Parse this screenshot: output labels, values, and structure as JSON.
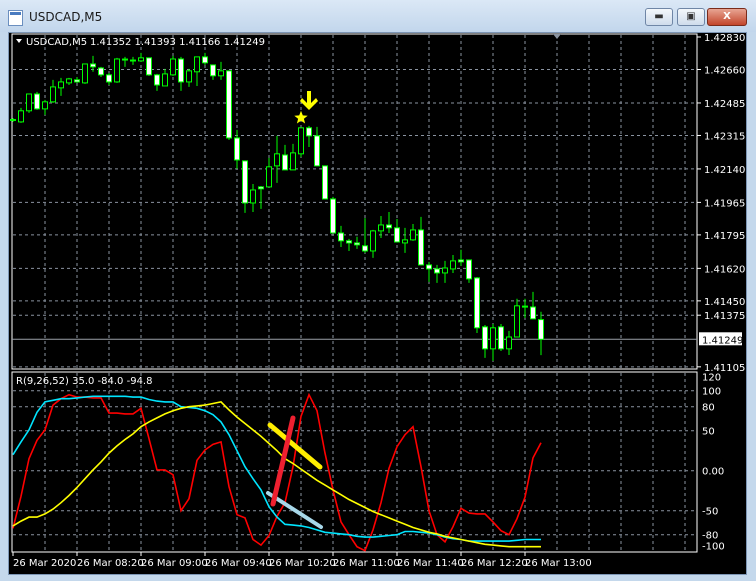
{
  "window": {
    "title": "USDCAD,M5",
    "buttons": [
      "minimize",
      "maximize",
      "close"
    ]
  },
  "chart": {
    "header_symbol": "USDCAD,M5",
    "header_ohlc": "1.41352 1.41393 1.41166 1.41249",
    "price_labels": [
      "1.42830",
      "1.42660",
      "1.42485",
      "1.42315",
      "1.42140",
      "1.41965",
      "1.41795",
      "1.41620",
      "1.41450",
      "1.41375",
      "1.41105"
    ],
    "current_price": "1.41249",
    "time_labels": [
      "26 Mar 2020",
      "26 Mar 08:20",
      "26 Mar 09:00",
      "26 Mar 09:40",
      "26 Mar 10:20",
      "26 Mar 11:00",
      "26 Mar 11:40",
      "26 Mar 12:20",
      "26 Mar 13:00"
    ],
    "colors": {
      "background": "#000000",
      "grid": "#8a93a0",
      "candle_outline": "#00ff00",
      "bear_fill": "#ffffff",
      "bull_fill": "#000000",
      "signal": "#ffff00"
    }
  },
  "indicator": {
    "label": "R(9,26,52) 35.0 -84.0 -94.8",
    "axis_labels": [
      "120",
      "100",
      "80",
      "50",
      "0.00",
      "-50",
      "-80",
      "-100"
    ],
    "colors": {
      "fast": "#ff0000",
      "medium": "#00e5ff",
      "slow": "#ffff00",
      "trend_red": "#ee2030",
      "trend_yellow": "#ffee00",
      "trend_blue": "#a8d8ea"
    }
  },
  "chart_data": {
    "type": "candlestick",
    "symbol": "USDCAD",
    "timeframe": "M5",
    "ylim": [
      1.41105,
      1.4283
    ],
    "candles": [
      [
        "07:40",
        1.42396,
        1.42406,
        1.42386,
        1.42396
      ],
      [
        "07:45",
        1.42386,
        1.42459,
        1.42381,
        1.42444
      ],
      [
        "07:50",
        1.42444,
        1.42532,
        1.42433,
        1.42532
      ],
      [
        "07:55",
        1.42532,
        1.42543,
        1.42449,
        1.42454
      ],
      [
        "08:00",
        1.42454,
        1.42501,
        1.42423,
        1.42491
      ],
      [
        "08:05",
        1.42491,
        1.42606,
        1.42485,
        1.42569
      ],
      [
        "08:10",
        1.42564,
        1.42616,
        1.42522,
        1.42595
      ],
      [
        "08:15",
        1.4259,
        1.42616,
        1.42579,
        1.42611
      ],
      [
        "08:20",
        1.42606,
        1.42621,
        1.4259,
        1.42595
      ],
      [
        "08:25",
        1.4259,
        1.42689,
        1.42585,
        1.42689
      ],
      [
        "08:30",
        1.42689,
        1.42731,
        1.42648,
        1.42674
      ],
      [
        "08:35",
        1.42668,
        1.42674,
        1.42621,
        1.42632
      ],
      [
        "08:40",
        1.42632,
        1.42642,
        1.42579,
        1.42595
      ],
      [
        "08:45",
        1.42595,
        1.42721,
        1.4259,
        1.42715
      ],
      [
        "08:50",
        1.4271,
        1.42726,
        1.42674,
        1.42712
      ],
      [
        "08:55",
        1.42705,
        1.42726,
        1.42684,
        1.42707
      ],
      [
        "09:00",
        1.42705,
        1.42747,
        1.427,
        1.42721
      ],
      [
        "09:05",
        1.42721,
        1.42721,
        1.42627,
        1.42632
      ],
      [
        "09:10",
        1.42632,
        1.42637,
        1.42548,
        1.42579
      ],
      [
        "09:15",
        1.42574,
        1.42663,
        1.42574,
        1.42637
      ],
      [
        "09:20",
        1.42632,
        1.42731,
        1.42627,
        1.42715
      ],
      [
        "09:25",
        1.42715,
        1.42726,
        1.42548,
        1.42595
      ],
      [
        "09:30",
        1.42595,
        1.42663,
        1.42569,
        1.42653
      ],
      [
        "09:35",
        1.42648,
        1.42726,
        1.42574,
        1.42726
      ],
      [
        "09:40",
        1.42726,
        1.42747,
        1.42684,
        1.42695
      ],
      [
        "09:45",
        1.42684,
        1.42684,
        1.42606,
        1.42627
      ],
      [
        "09:50",
        1.42627,
        1.427,
        1.42606,
        1.42653
      ],
      [
        "09:55",
        1.42653,
        1.42653,
        1.42292,
        1.42302
      ],
      [
        "10:00",
        1.42302,
        1.42344,
        1.4214,
        1.42187
      ],
      [
        "10:05",
        1.42182,
        1.42182,
        1.4191,
        1.41962
      ],
      [
        "10:10",
        1.41962,
        1.42061,
        1.41915,
        1.4203
      ],
      [
        "10:15",
        1.42046,
        1.42051,
        1.41931,
        1.42036
      ],
      [
        "10:20",
        1.42046,
        1.42198,
        1.42046,
        1.42151
      ],
      [
        "10:25",
        1.42156,
        1.42313,
        1.42067,
        1.42219
      ],
      [
        "10:30",
        1.42213,
        1.42266,
        1.42135,
        1.42135
      ],
      [
        "10:35",
        1.42135,
        1.42271,
        1.42135,
        1.42224
      ],
      [
        "10:40",
        1.42219,
        1.42355,
        1.42203,
        1.42355
      ],
      [
        "10:45",
        1.42355,
        1.42365,
        1.42255,
        1.42313
      ],
      [
        "10:50",
        1.42313,
        1.4236,
        1.42156,
        1.42156
      ],
      [
        "10:55",
        1.42156,
        1.42156,
        1.41983,
        1.41983
      ],
      [
        "11:00",
        1.41983,
        1.41994,
        1.41805,
        1.41805
      ],
      [
        "11:05",
        1.41805,
        1.41842,
        1.41732,
        1.41764
      ],
      [
        "11:10",
        1.41764,
        1.41774,
        1.41711,
        1.41753
      ],
      [
        "11:15",
        1.41753,
        1.41785,
        1.41722,
        1.41743
      ],
      [
        "11:20",
        1.41738,
        1.41883,
        1.41701,
        1.41711
      ],
      [
        "11:25",
        1.41711,
        1.41821,
        1.41675,
        1.41816
      ],
      [
        "11:30",
        1.41816,
        1.41894,
        1.41779,
        1.41847
      ],
      [
        "11:35",
        1.41847,
        1.41915,
        1.41805,
        1.41832
      ],
      [
        "11:40",
        1.41832,
        1.41878,
        1.41758,
        1.41758
      ],
      [
        "11:45",
        1.41753,
        1.41832,
        1.41701,
        1.41769
      ],
      [
        "11:50",
        1.41769,
        1.41852,
        1.41764,
        1.41821
      ],
      [
        "11:55",
        1.41821,
        1.41889,
        1.41638,
        1.41638
      ],
      [
        "12:00",
        1.41638,
        1.41654,
        1.41549,
        1.41617
      ],
      [
        "12:05",
        1.41617,
        1.41638,
        1.41544,
        1.41596
      ],
      [
        "12:10",
        1.41596,
        1.41659,
        1.41544,
        1.41622
      ],
      [
        "12:15",
        1.41617,
        1.4169,
        1.41596,
        1.41659
      ],
      [
        "12:20",
        1.41664,
        1.41717,
        1.41633,
        1.41654
      ],
      [
        "12:25",
        1.41664,
        1.41664,
        1.41544,
        1.41565
      ],
      [
        "12:30",
        1.4157,
        1.41575,
        1.41282,
        1.41309
      ],
      [
        "12:35",
        1.41314,
        1.41324,
        1.41152,
        1.41199
      ],
      [
        "12:40",
        1.41199,
        1.41329,
        1.41136,
        1.41309
      ],
      [
        "12:45",
        1.41314,
        1.41329,
        1.41188,
        1.41199
      ],
      [
        "12:50",
        1.41199,
        1.41293,
        1.41167,
        1.41261
      ],
      [
        "12:55",
        1.41261,
        1.41461,
        1.41261,
        1.41424
      ],
      [
        "13:00",
        1.41418,
        1.41461,
        1.41361,
        1.4142
      ],
      [
        "13:05",
        1.41418,
        1.41497,
        1.41356,
        1.41356
      ],
      [
        "13:10",
        1.41352,
        1.41393,
        1.41166,
        1.41249
      ]
    ],
    "signal_candle": "10:40",
    "indicator": {
      "ylim": [
        -100,
        120
      ],
      "series": [
        {
          "color": "#ff0000",
          "values": [
            -72,
            -32,
            15,
            38,
            51,
            82,
            90,
            95,
            92,
            92,
            91,
            91,
            72,
            72,
            71,
            71,
            78,
            40,
            1,
            1,
            -5,
            -50,
            -35,
            13,
            26,
            33,
            36,
            -20,
            -55,
            -59,
            -86,
            -93,
            -81,
            -57,
            -40,
            5,
            68,
            95,
            75,
            22,
            -24,
            -64,
            -80,
            -95,
            -100,
            -74,
            -40,
            3,
            30,
            45,
            55,
            5,
            -50,
            -80,
            -89,
            -70,
            -47,
            -53,
            -54,
            -54,
            -64,
            -75,
            -80,
            -60,
            -33,
            16,
            35
          ]
        },
        {
          "color": "#00e5ff",
          "values": [
            20,
            36,
            51,
            73,
            86,
            88,
            90,
            90,
            91,
            92,
            93,
            93,
            93,
            93,
            93,
            92,
            92,
            89,
            87,
            86,
            86,
            80,
            79,
            78,
            75,
            70,
            61,
            45,
            25,
            5,
            -10,
            -24,
            -45,
            -58,
            -67,
            -68,
            -69,
            -71,
            -74,
            -77,
            -78,
            -79,
            -80,
            -82,
            -83,
            -83,
            -82,
            -81,
            -80,
            -76,
            -76,
            -77,
            -78,
            -80,
            -83,
            -85,
            -86,
            -88,
            -88,
            -88,
            -88,
            -88,
            -88,
            -87,
            -86,
            -86,
            -86
          ]
        },
        {
          "color": "#ffff00",
          "values": [
            -69,
            -63,
            -58,
            -58,
            -54,
            -48,
            -40,
            -31,
            -21,
            -10,
            1,
            11,
            22,
            31,
            39,
            46,
            55,
            61,
            66,
            71,
            75,
            78,
            80,
            81,
            82,
            84,
            86,
            76,
            67,
            59,
            51,
            43,
            34,
            25,
            15,
            9,
            2,
            -5,
            -12,
            -18,
            -24,
            -30,
            -36,
            -41,
            -46,
            -51,
            -55,
            -59,
            -63,
            -67,
            -71,
            -74,
            -77,
            -79,
            -82,
            -84,
            -86,
            -88,
            -90,
            -92,
            -93,
            -94,
            -95,
            -95,
            -95,
            -95,
            -95
          ]
        }
      ]
    }
  }
}
